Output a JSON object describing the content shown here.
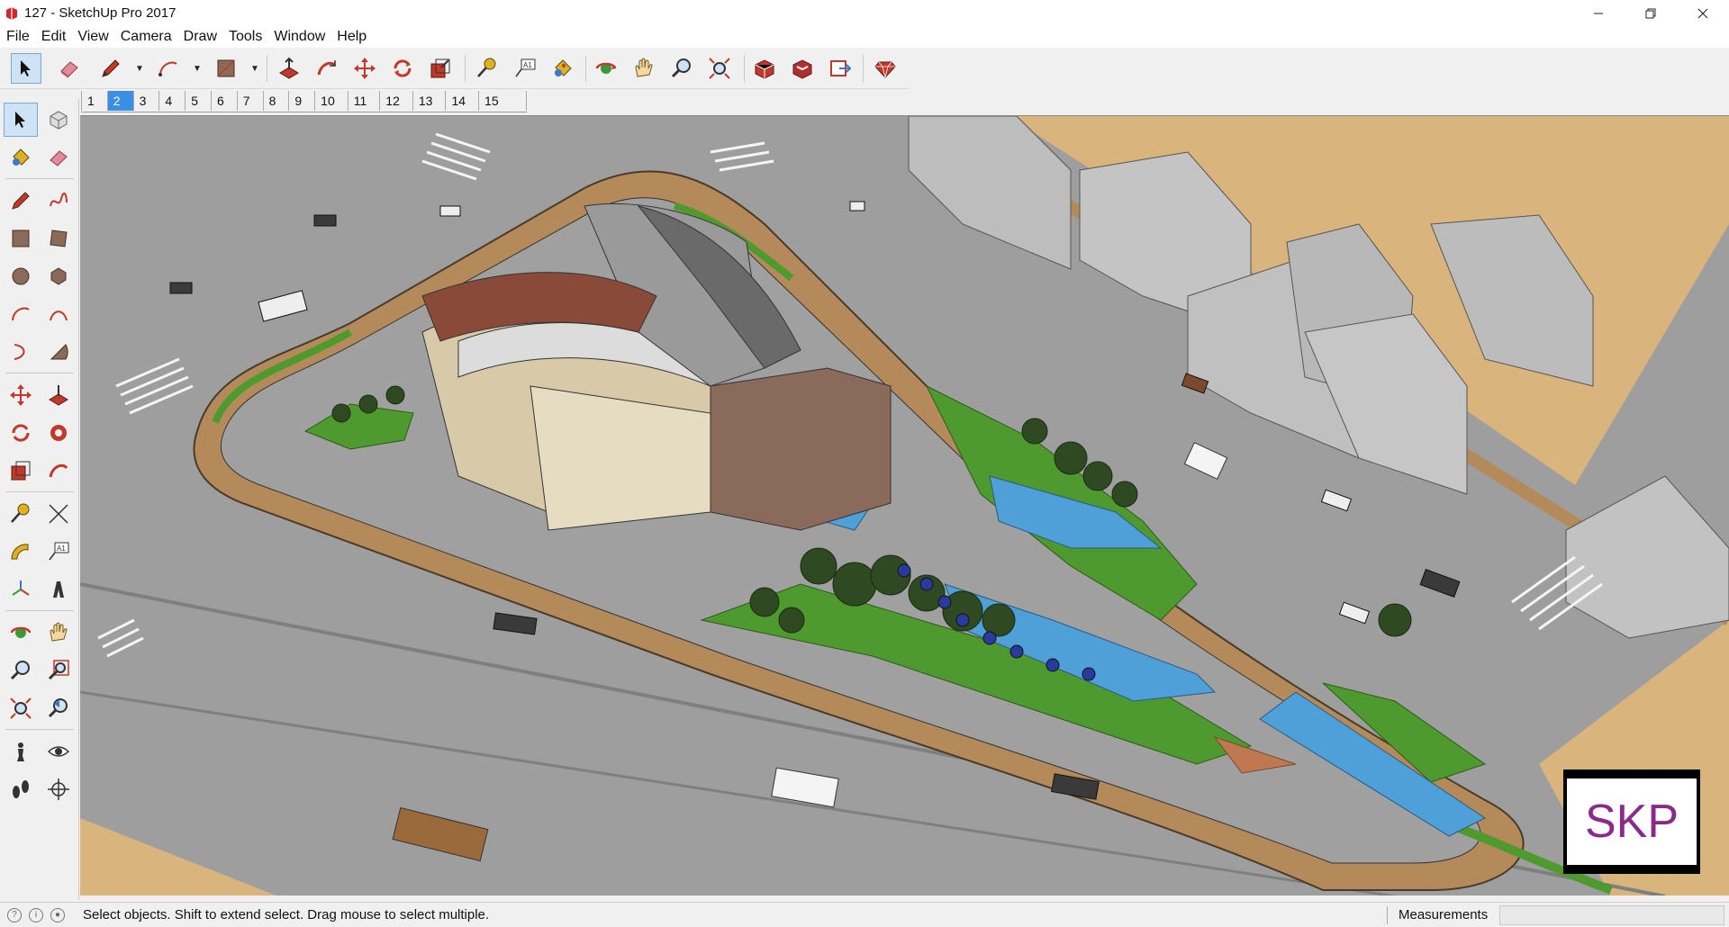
{
  "window": {
    "title": "127 - SketchUp Pro 2017",
    "buttons": [
      "minimize",
      "restore",
      "close"
    ]
  },
  "menu": {
    "items": [
      "File",
      "Edit",
      "View",
      "Camera",
      "Draw",
      "Tools",
      "Window",
      "Help"
    ]
  },
  "toolbar": {
    "tools": [
      "select-icon",
      "eraser-icon",
      "pencil-icon",
      "arc-icon",
      "rectangle-icon",
      "push-pull-icon",
      "follow-me-icon",
      "move-icon",
      "rotate-icon",
      "scale-icon",
      "tape-measure-icon",
      "text-icon",
      "paint-bucket-icon",
      "orbit-icon",
      "pan-icon",
      "zoom-icon",
      "zoom-extents-icon",
      "3d-warehouse-icon",
      "extension-warehouse-icon",
      "send-to-layout-icon",
      "ruby-console-icon"
    ]
  },
  "scenes": {
    "tabs": [
      "1",
      "2",
      "3",
      "4",
      "5",
      "6",
      "7",
      "8",
      "9",
      "10",
      "11",
      "12",
      "13",
      "14",
      "15"
    ],
    "active_index": 1
  },
  "left_toolbar": {
    "tools": [
      "select-icon",
      "component-icon",
      "paint-bucket-icon",
      "eraser-icon",
      "pencil-icon",
      "freehand-icon",
      "rectangle-icon",
      "rotated-rectangle-icon",
      "circle-icon",
      "polygon-icon",
      "arc-icon",
      "two-point-arc-icon",
      "three-point-arc-icon",
      "pie-icon",
      "move-icon",
      "push-pull-icon",
      "rotate-icon",
      "follow-me-icon",
      "scale-icon",
      "offset-icon",
      "tape-measure-icon",
      "dimension-icon",
      "protractor-icon",
      "text-icon",
      "axes-icon",
      "3d-text-icon",
      "orbit-icon",
      "pan-icon",
      "zoom-icon",
      "zoom-window-icon",
      "zoom-extents-icon",
      "previous-view-icon",
      "position-camera-icon",
      "look-around-icon",
      "walk-icon",
      "section-plane-icon"
    ]
  },
  "status": {
    "message": "Select objects. Shift to extend select. Drag mouse to select multiple.",
    "measurements_label": "Measurements",
    "measurements_value": ""
  },
  "watermark": {
    "text": "SKP"
  },
  "colors": {
    "accent": "#3a8ee6",
    "road": "#9e9e9e",
    "grass": "#4f9a2f",
    "sand": "#d9b47c",
    "water": "#4f9fd8"
  }
}
